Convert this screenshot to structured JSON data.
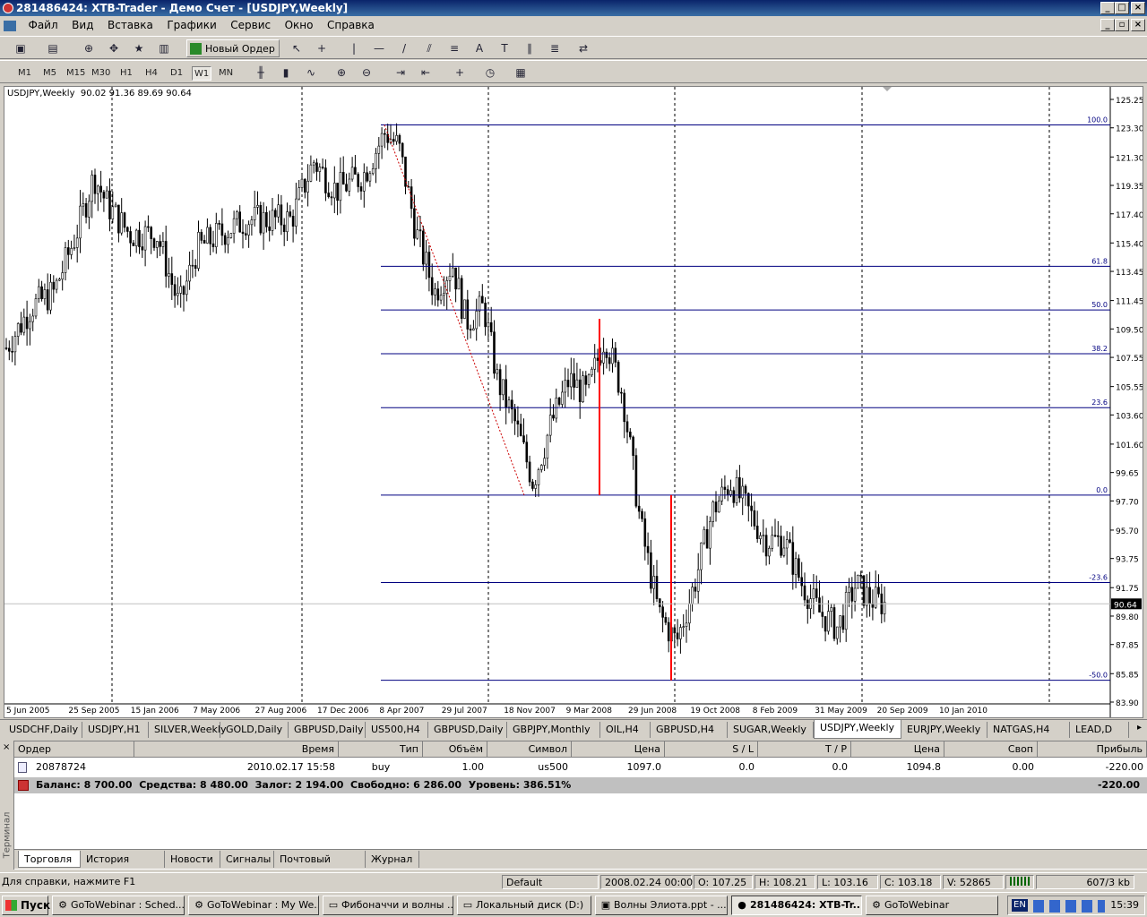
{
  "window": {
    "title": "281486424: XTB-Trader - Демо Счет - [USDJPY,Weekly]"
  },
  "menu": [
    "Файл",
    "Вид",
    "Вставка",
    "Графики",
    "Сервис",
    "Окно",
    "Справка"
  ],
  "toolbar": {
    "new_order_label": "Новый Ордер"
  },
  "timeframes": [
    "M1",
    "M5",
    "M15",
    "M30",
    "H1",
    "H4",
    "D1",
    "W1",
    "MN"
  ],
  "active_timeframe": "W1",
  "chart": {
    "header_text": "USDJPY,Weekly  90.02 91.36 89.69 90.64",
    "current_price": "90.64",
    "price_labels": [
      "125.25",
      "123.30",
      "121.30",
      "119.35",
      "117.40",
      "115.40",
      "113.45",
      "111.45",
      "109.50",
      "107.55",
      "105.55",
      "103.60",
      "101.60",
      "99.65",
      "97.70",
      "95.70",
      "93.75",
      "91.75",
      "89.80",
      "87.85",
      "85.85",
      "83.90"
    ],
    "date_labels": [
      "5 Jun 2005",
      "25 Sep 2005",
      "15 Jan 2006",
      "7 May 2006",
      "27 Aug 2006",
      "17 Dec 2006",
      "8 Apr 2007",
      "29 Jul 2007",
      "18 Nov 2007",
      "9 Mar 2008",
      "29 Jun 2008",
      "19 Oct 2008",
      "8 Feb 2009",
      "31 May 2009",
      "20 Sep 2009",
      "10 Jan 2010"
    ],
    "fib_levels": [
      {
        "label": "100.0",
        "price": 123.5
      },
      {
        "label": "61.8",
        "price": 113.8
      },
      {
        "label": "50.0",
        "price": 110.8
      },
      {
        "label": "38.2",
        "price": 107.8
      },
      {
        "label": "23.6",
        "price": 104.1
      },
      {
        "label": "0.0",
        "price": 98.1
      },
      {
        "label": "-23.6",
        "price": 92.1
      },
      {
        "label": "-50.0",
        "price": 85.4
      }
    ],
    "colors": {
      "fib": "#000080",
      "candle": "#000000",
      "highlight": "#ff0000",
      "dotted": "#cc0000"
    }
  },
  "chart_data": {
    "type": "candlestick",
    "series": [
      {
        "name": "USDJPY,Weekly",
        "ohlc_last": [
          90.02,
          91.36,
          89.69,
          90.64
        ]
      }
    ],
    "ylim": [
      83.9,
      125.25
    ]
  },
  "symbol_tabs": [
    "USDCHF,Daily",
    "USDJPY,H1",
    "SILVER,Weekly",
    "GOLD,Daily",
    "GBPUSD,Daily",
    "US500,H4",
    "GBPUSD,Daily",
    "GBPJPY,Monthly",
    "OIL,H4",
    "GBPUSD,H4",
    "SUGAR,Weekly",
    "USDJPY,Weekly",
    "EURJPY,Weekly",
    "NATGAS,H4",
    "LEAD,D"
  ],
  "active_symbol_tab": 11,
  "terminal": {
    "side_label": "Терминал",
    "headers": [
      "Ордер",
      "Время",
      "Тип",
      "Объём",
      "Символ",
      "Цена",
      "S / L",
      "T / P",
      "Цена",
      "Своп",
      "Прибыль"
    ],
    "rows": [
      [
        "20878724",
        "2010.02.17 15:58",
        "buy",
        "1.00",
        "us500",
        "1097.0",
        "0.0",
        "0.0",
        "1094.8",
        "0.00",
        "-220.00"
      ]
    ],
    "balance_text": "Баланс: 8 700.00  Средства: 8 480.00  Залог: 2 194.00  Свободно: 6 286.00  Уровень: 386.51%",
    "balance_profit": "-220.00",
    "tabs": [
      "Торговля",
      "История Счета",
      "Новости",
      "Сигналы",
      "Почтовый ящик",
      "Журнал"
    ]
  },
  "status": {
    "help": "Для справки, нажмите F1",
    "profile": "Default",
    "datetime": "2008.02.24 00:00",
    "open": "O: 107.25",
    "high": "H: 108.21",
    "low": "L: 103.16",
    "close": "C: 103.18",
    "volume": "V: 52865",
    "traffic": "607/3 kb"
  },
  "taskbar": {
    "start": "Пуск",
    "tasks": [
      "GoToWebinar : Sched...",
      "GoToWebinar : My We...",
      "Фибоначчи и волны ...",
      "Локальный диск (D:)",
      "Волны Элиота.ppt - ...",
      "281486424: XTB-Tr...",
      "GoToWebinar"
    ],
    "active_task": 5,
    "lang": "EN",
    "clock": "15:39"
  }
}
